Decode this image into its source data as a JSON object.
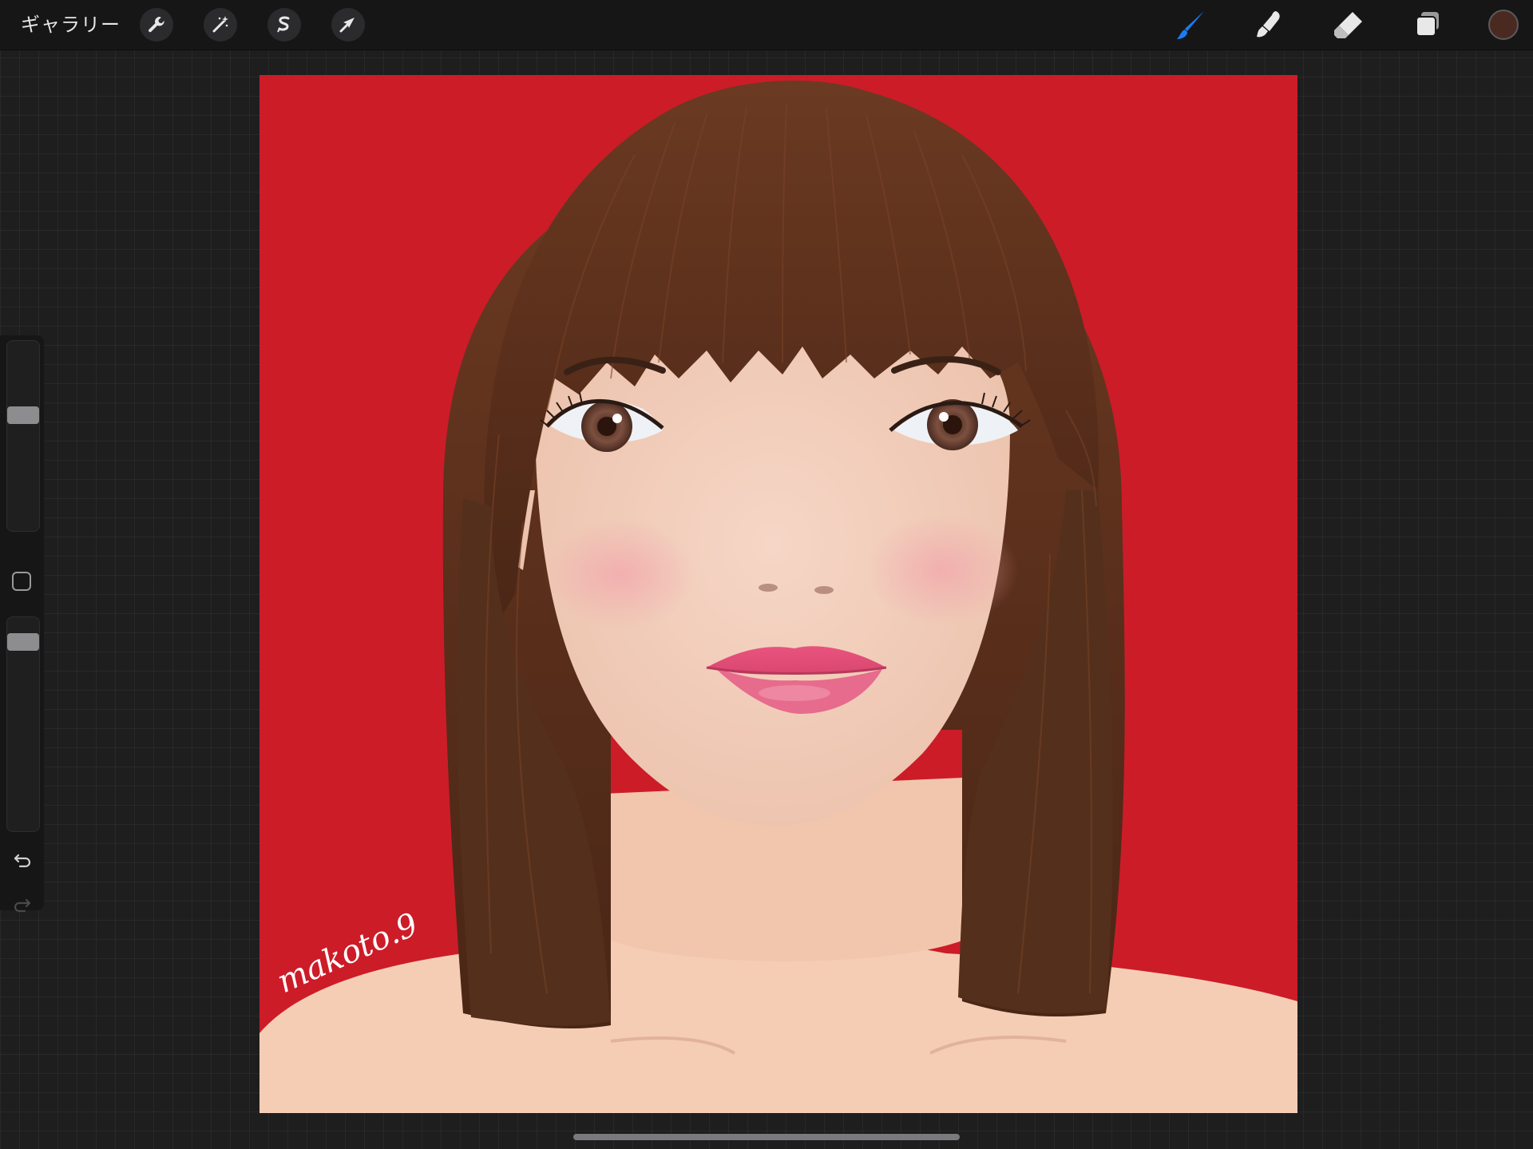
{
  "toolbar": {
    "gallery_label": "ギャラリー",
    "left_tools": [
      "wrench-icon",
      "magic-wand-icon",
      "selection-icon",
      "transform-arrow-icon"
    ],
    "right_tools": [
      "brush-icon",
      "smudge-icon",
      "eraser-icon",
      "layers-icon"
    ],
    "active_tool": "brush",
    "active_tool_color": "#1a7cf0",
    "current_color": "#4a2a20"
  },
  "sidebar": {
    "brush_size_level": 0.62,
    "opacity_level": 0.92,
    "buttons": [
      "undo-icon",
      "redo-icon"
    ]
  },
  "canvas": {
    "background_color": "#cc1c28",
    "signature_text": "makoto.9"
  }
}
